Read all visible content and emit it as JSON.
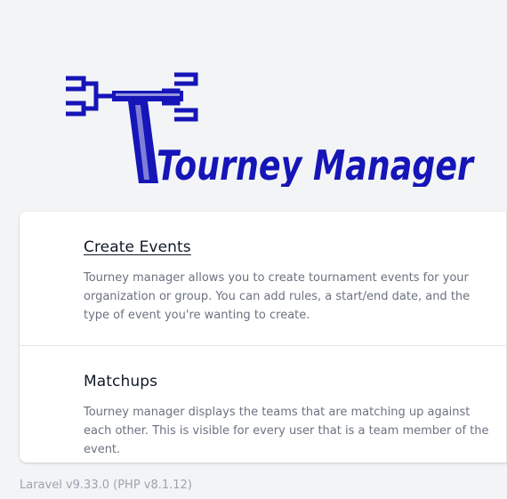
{
  "logo": {
    "alt_text": "Tourney Manager",
    "color": "#1515b8"
  },
  "sections": [
    {
      "title": "Create Events",
      "text": "Tourney manager allows you to create tournament events for your organization or group. You can add rules, a start/end date, and the type of event you're wanting to create."
    },
    {
      "title": "Matchups",
      "text": "Tourney manager displays the teams that are matching up against each other. This is visible for every user that is a team member of the event."
    }
  ],
  "footer": {
    "version": "Laravel v9.33.0 (PHP v8.1.12)"
  }
}
